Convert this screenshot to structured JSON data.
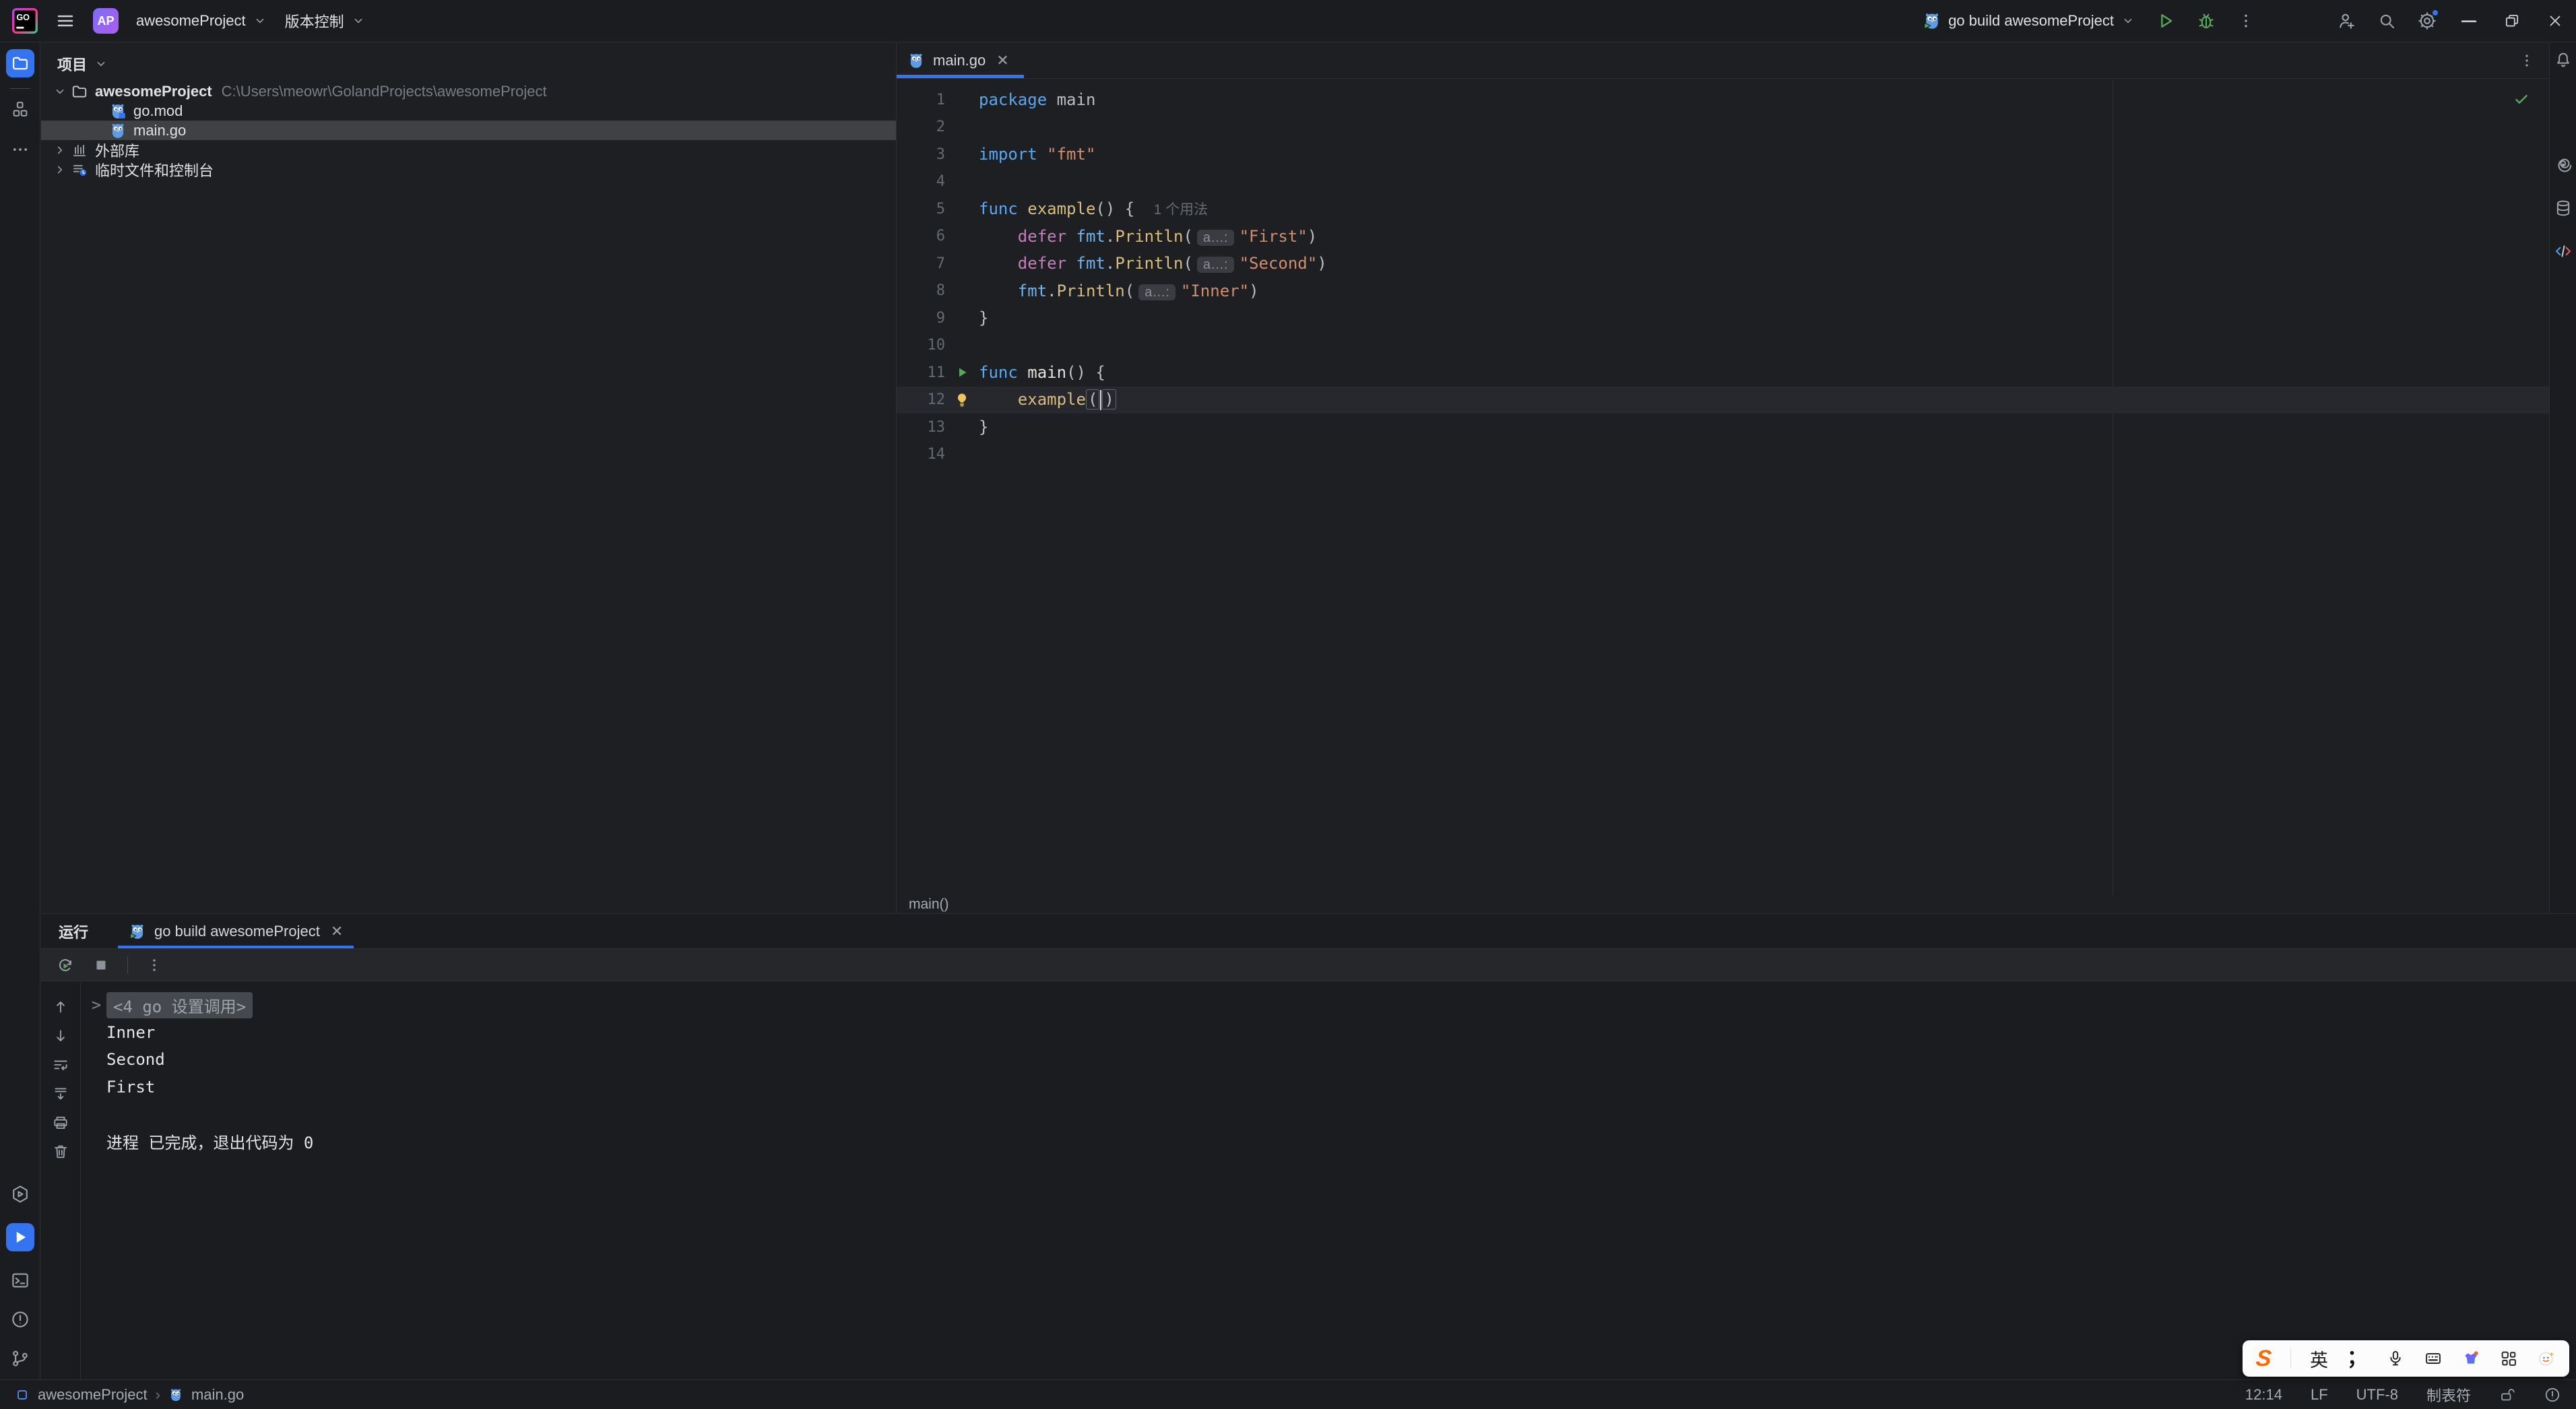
{
  "titlebar": {
    "project_badge": "AP",
    "project_name": "awesomeProject",
    "vcs_label": "版本控制",
    "run_config_label": "go build awesomeProject"
  },
  "left_stripe": {
    "top": [
      {
        "name": "project-tool-button",
        "icon": "folder",
        "active": true
      },
      {
        "name": "structure-tool-button",
        "icon": "structure",
        "active": false
      },
      {
        "name": "more-tools-button",
        "icon": "dots",
        "active": false
      }
    ],
    "bottom": [
      {
        "name": "services-tool-button",
        "icon": "services",
        "active": false
      },
      {
        "name": "run-tool-button",
        "icon": "play-solid",
        "active": true
      },
      {
        "name": "terminal-tool-button",
        "icon": "terminal",
        "active": false
      },
      {
        "name": "problems-tool-button",
        "icon": "problem",
        "active": false
      },
      {
        "name": "git-tool-button",
        "icon": "git",
        "active": false
      }
    ]
  },
  "right_stripe": [
    "bell",
    "ai",
    "database",
    "codetag"
  ],
  "project_panel": {
    "title": "项目",
    "tree": [
      {
        "level": 0,
        "chevron": "down",
        "icon": "folder-tree",
        "name": "awesomeProject",
        "bold": true,
        "path": "C:\\Users\\meowr\\GolandProjects\\awesomeProject",
        "selected": false
      },
      {
        "level": 1,
        "icon": "gopher-mod",
        "name": "go.mod",
        "selected": false
      },
      {
        "level": 1,
        "icon": "gopher",
        "name": "main.go",
        "selected": true
      },
      {
        "level": 0,
        "chevron": "right",
        "icon": "library",
        "name": "外部库",
        "selected": false
      },
      {
        "level": 0,
        "chevron": "right",
        "icon": "scratch",
        "name": "临时文件和控制台",
        "selected": false
      }
    ]
  },
  "editor": {
    "tab_label": "main.go",
    "breadcrumb": "main()",
    "lines": [
      {
        "tokens": [
          {
            "c": "kw",
            "t": "package"
          },
          {
            "c": "pl",
            "t": " main"
          }
        ]
      },
      {
        "tokens": []
      },
      {
        "tokens": [
          {
            "c": "kw",
            "t": "import"
          },
          {
            "c": "pl",
            "t": " "
          },
          {
            "c": "str",
            "t": "\"fmt\""
          }
        ]
      },
      {
        "tokens": []
      },
      {
        "tokens": [
          {
            "c": "kw",
            "t": "func"
          },
          {
            "c": "pl",
            "t": " "
          },
          {
            "c": "fn",
            "t": "example"
          },
          {
            "c": "pl",
            "t": "() { "
          },
          {
            "c": "hint",
            "t": "1 个用法"
          }
        ]
      },
      {
        "tokens": [
          {
            "c": "pl",
            "t": "    "
          },
          {
            "c": "def",
            "t": "defer"
          },
          {
            "c": "pl",
            "t": " "
          },
          {
            "c": "pkg",
            "t": "fmt"
          },
          {
            "c": "pl",
            "t": "."
          },
          {
            "c": "fn",
            "t": "Println"
          },
          {
            "c": "pl",
            "t": "("
          },
          {
            "c": "chip",
            "t": "a…:"
          },
          {
            "c": "str",
            "t": "\"First\""
          },
          {
            "c": "pl",
            "t": ")"
          }
        ]
      },
      {
        "tokens": [
          {
            "c": "pl",
            "t": "    "
          },
          {
            "c": "def",
            "t": "defer"
          },
          {
            "c": "pl",
            "t": " "
          },
          {
            "c": "pkg",
            "t": "fmt"
          },
          {
            "c": "pl",
            "t": "."
          },
          {
            "c": "fn",
            "t": "Println"
          },
          {
            "c": "pl",
            "t": "("
          },
          {
            "c": "chip",
            "t": "a…:"
          },
          {
            "c": "str",
            "t": "\"Second\""
          },
          {
            "c": "pl",
            "t": ")"
          }
        ]
      },
      {
        "tokens": [
          {
            "c": "pl",
            "t": "    "
          },
          {
            "c": "pkg",
            "t": "fmt"
          },
          {
            "c": "pl",
            "t": "."
          },
          {
            "c": "fn",
            "t": "Println"
          },
          {
            "c": "pl",
            "t": "("
          },
          {
            "c": "chip",
            "t": "a…:"
          },
          {
            "c": "str",
            "t": "\"Inner\""
          },
          {
            "c": "pl",
            "t": ")"
          }
        ]
      },
      {
        "tokens": [
          {
            "c": "pl",
            "t": "}"
          }
        ]
      },
      {
        "tokens": []
      },
      {
        "marker": "run",
        "tokens": [
          {
            "c": "kw",
            "t": "func"
          },
          {
            "c": "pl",
            "t": " "
          },
          {
            "c": "fnw",
            "t": "main"
          },
          {
            "c": "pl",
            "t": "() {"
          }
        ]
      },
      {
        "marker": "bulb",
        "active": true,
        "tokens": [
          {
            "c": "pl",
            "t": "    "
          },
          {
            "c": "fn",
            "t": "example"
          },
          {
            "c": "brace",
            "t": "("
          },
          {
            "c": "caret",
            "t": ""
          },
          {
            "c": "brace",
            "t": ")"
          }
        ]
      },
      {
        "tokens": [
          {
            "c": "pl",
            "t": "}"
          }
        ]
      },
      {
        "tokens": []
      }
    ]
  },
  "run_panel": {
    "title": "运行",
    "tab_label": "go build awesomeProject",
    "gutter_icons": [
      "arrow-up",
      "arrow-down",
      "softwrap",
      "scrollend",
      "printer",
      "trash"
    ],
    "console": [
      {
        "fold": true,
        "expander": ">",
        "text": "<4 go 设置调用>"
      },
      {
        "text": "Inner"
      },
      {
        "text": "Second"
      },
      {
        "text": "First"
      },
      {
        "text": ""
      },
      {
        "text": "进程 已完成，退出代码为 0"
      }
    ]
  },
  "status_bar": {
    "project": "awesomeProject",
    "separator": "›",
    "file": "main.go",
    "right": [
      "12:14",
      "LF",
      "UTF-8",
      "制表符"
    ]
  },
  "ime": {
    "items": [
      {
        "type": "logo",
        "name": "sogou-logo",
        "text": "S"
      },
      {
        "type": "div"
      },
      {
        "type": "text",
        "name": "ime-mode-english",
        "text": "英"
      },
      {
        "type": "semi",
        "name": "ime-punctuation",
        "text": "；"
      },
      {
        "type": "icon",
        "name": "mic-icon",
        "icon": "mic"
      },
      {
        "type": "icon",
        "name": "keyboard-icon",
        "icon": "keyboard"
      },
      {
        "type": "icon",
        "name": "skin-icon",
        "icon": "skin"
      },
      {
        "type": "icon",
        "name": "toolbox-grid-icon",
        "icon": "grid"
      },
      {
        "type": "icon",
        "name": "assistant-face-icon",
        "icon": "face"
      }
    ]
  },
  "colors": {
    "accent": "#3574F0",
    "run_green": "#57A85C",
    "bulb_yellow": "#F2C55C",
    "selection_row": "#3F4145"
  }
}
